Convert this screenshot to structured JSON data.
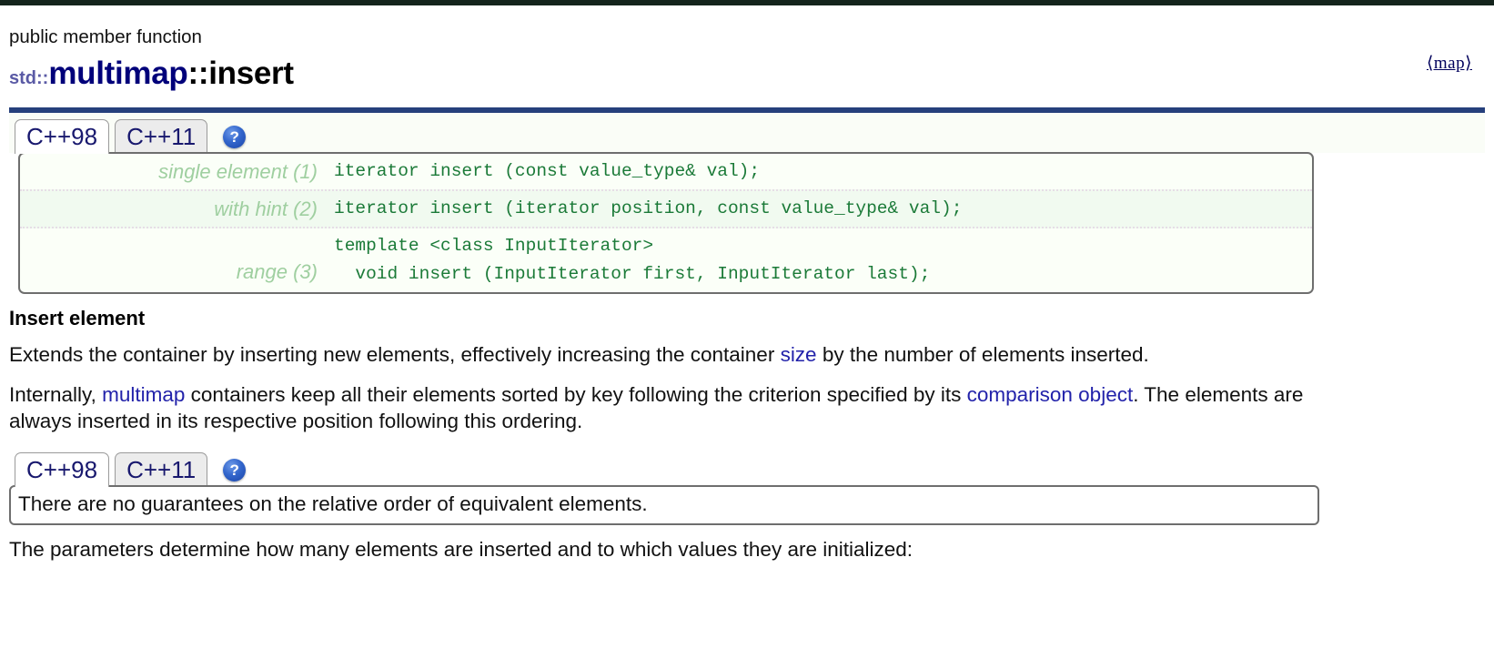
{
  "header": {
    "eyebrow": "public member function",
    "namespace": "std::",
    "class_name": "multimap",
    "separator": "::",
    "member": "insert",
    "header_tag": "⟨map⟩",
    "rule_color": "#26407c"
  },
  "tabs_top": {
    "items": [
      {
        "label": "C++98",
        "active": true
      },
      {
        "label": "C++11",
        "active": false
      }
    ],
    "help_icon": "help-icon",
    "help_glyph": "?"
  },
  "prototypes": [
    {
      "label": "single element (1)",
      "code": "iterator insert (const value_type& val);"
    },
    {
      "label": "with hint (2)",
      "code": "iterator insert (iterator position, const value_type& val);"
    },
    {
      "label": "range (3)",
      "code": "template <class InputIterator>\n  void insert (InputIterator first, InputIterator last);"
    }
  ],
  "section": {
    "heading": "Insert element",
    "paragraph1": {
      "part1": "Extends the container by inserting new elements, effectively increasing the container ",
      "link1": "size",
      "part2": " by the number of elements inserted."
    },
    "paragraph2": {
      "part1": "Internally, ",
      "link1": "multimap",
      "part2": " containers keep all their elements sorted by key following the criterion specified by its ",
      "link2": "comparison object",
      "part3": ". The elements are always inserted in its respective position following this ordering."
    }
  },
  "tabs_second": {
    "items": [
      {
        "label": "C++98",
        "active": true
      },
      {
        "label": "C++11",
        "active": false
      }
    ],
    "help_icon": "help-icon",
    "help_glyph": "?"
  },
  "note": {
    "text": "There are no guarantees on the relative order of equivalent elements."
  },
  "footer_paragraph": "The parameters determine how many elements are inserted and to which values they are initialized:",
  "colors": {
    "link": "#2222aa",
    "class_name": "#00007a",
    "namespace": "#5a5aa5",
    "code_green": "#1b7a38",
    "label_green": "#9fcfa0",
    "rule_blue": "#26407c",
    "border_gray": "#6e6e6e"
  }
}
